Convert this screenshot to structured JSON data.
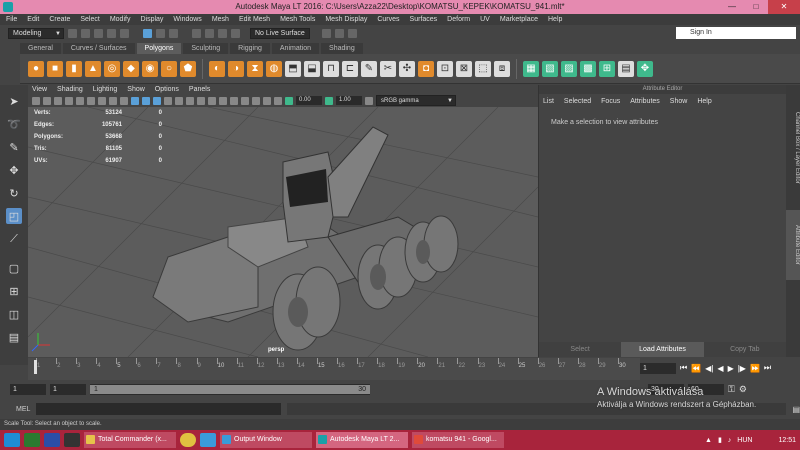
{
  "window": {
    "title": "Autodesk Maya LT 2016: C:\\Users\\Azza22\\Desktop\\KOMATSU_KEPEK\\KOMATSU_941.mlt*",
    "minimize": "—",
    "maximize": "□",
    "close": "✕"
  },
  "menubar": [
    "File",
    "Edit",
    "Create",
    "Select",
    "Modify",
    "Display",
    "Windows",
    "Mesh",
    "Edit Mesh",
    "Mesh Tools",
    "Mesh Display",
    "Curves",
    "Surfaces",
    "Deform",
    "UV",
    "Marketplace",
    "Help"
  ],
  "statusline": {
    "mode": "Modeling",
    "live_surface": "No Live Surface",
    "sign_in": "Sign In"
  },
  "shelf": {
    "tabs": [
      "General",
      "Curves / Surfaces",
      "Polygons",
      "Sculpting",
      "Rigging",
      "Animation",
      "Shading"
    ],
    "active_tab": "Polygons"
  },
  "viewport": {
    "menu": [
      "View",
      "Shading",
      "Lighting",
      "Show",
      "Options",
      "Panels"
    ],
    "near_value": "0.00",
    "far_value": "1.00",
    "color_space": "sRGB gamma",
    "camera": "persp",
    "hud": [
      {
        "label": "Verts:",
        "v1": "53124",
        "v2": "0"
      },
      {
        "label": "Edges:",
        "v1": "105761",
        "v2": "0"
      },
      {
        "label": "Polygons:",
        "v1": "53668",
        "v2": "0"
      },
      {
        "label": "Tris:",
        "v1": "81105",
        "v2": "0"
      },
      {
        "label": "UVs:",
        "v1": "61907",
        "v2": "0"
      }
    ]
  },
  "attribute_editor": {
    "title": "Attribute Editor",
    "menu": [
      "List",
      "Selected",
      "Focus",
      "Attributes",
      "Show",
      "Help"
    ],
    "message": "Make a selection to view attributes",
    "buttons": [
      "Select",
      "Load Attributes",
      "Copy Tab"
    ]
  },
  "side_tabs": [
    "Channel Box / Layer Editor",
    "Attribute Editor"
  ],
  "timeline": {
    "ticks": [
      "1",
      "2",
      "3",
      "4",
      "5",
      "6",
      "7",
      "8",
      "9",
      "10",
      "11",
      "12",
      "13",
      "14",
      "15",
      "16",
      "17",
      "18",
      "19",
      "20",
      "21",
      "22",
      "23",
      "24",
      "25",
      "26",
      "27",
      "28",
      "29",
      "30"
    ],
    "labeled": [
      "5",
      "10",
      "15",
      "20",
      "25",
      "30"
    ],
    "current_frame": "1"
  },
  "range": {
    "start": "1",
    "anim_start": "1",
    "slider_start": "1",
    "slider_end": "30",
    "end": "30",
    "anim_end": "60"
  },
  "mel": {
    "label": "MEL"
  },
  "help_line": "Scale Tool: Select an object to scale.",
  "watermark": {
    "line1": "A Windows aktiválása",
    "line2": "Aktiválja a Windows rendszert a Gépházban."
  },
  "taskbar": {
    "tasks": [
      {
        "label": "Total Commander (x...",
        "color": "#e6c24a"
      },
      {
        "label": "Output Window",
        "color": "#3a9ad9"
      },
      {
        "label": "Autodesk Maya LT 2...",
        "color": "#1aa0a8"
      },
      {
        "label": "komatsu 941 - Googl...",
        "color": "#e04a3a"
      }
    ],
    "language": "HUN",
    "time": "12:51"
  }
}
